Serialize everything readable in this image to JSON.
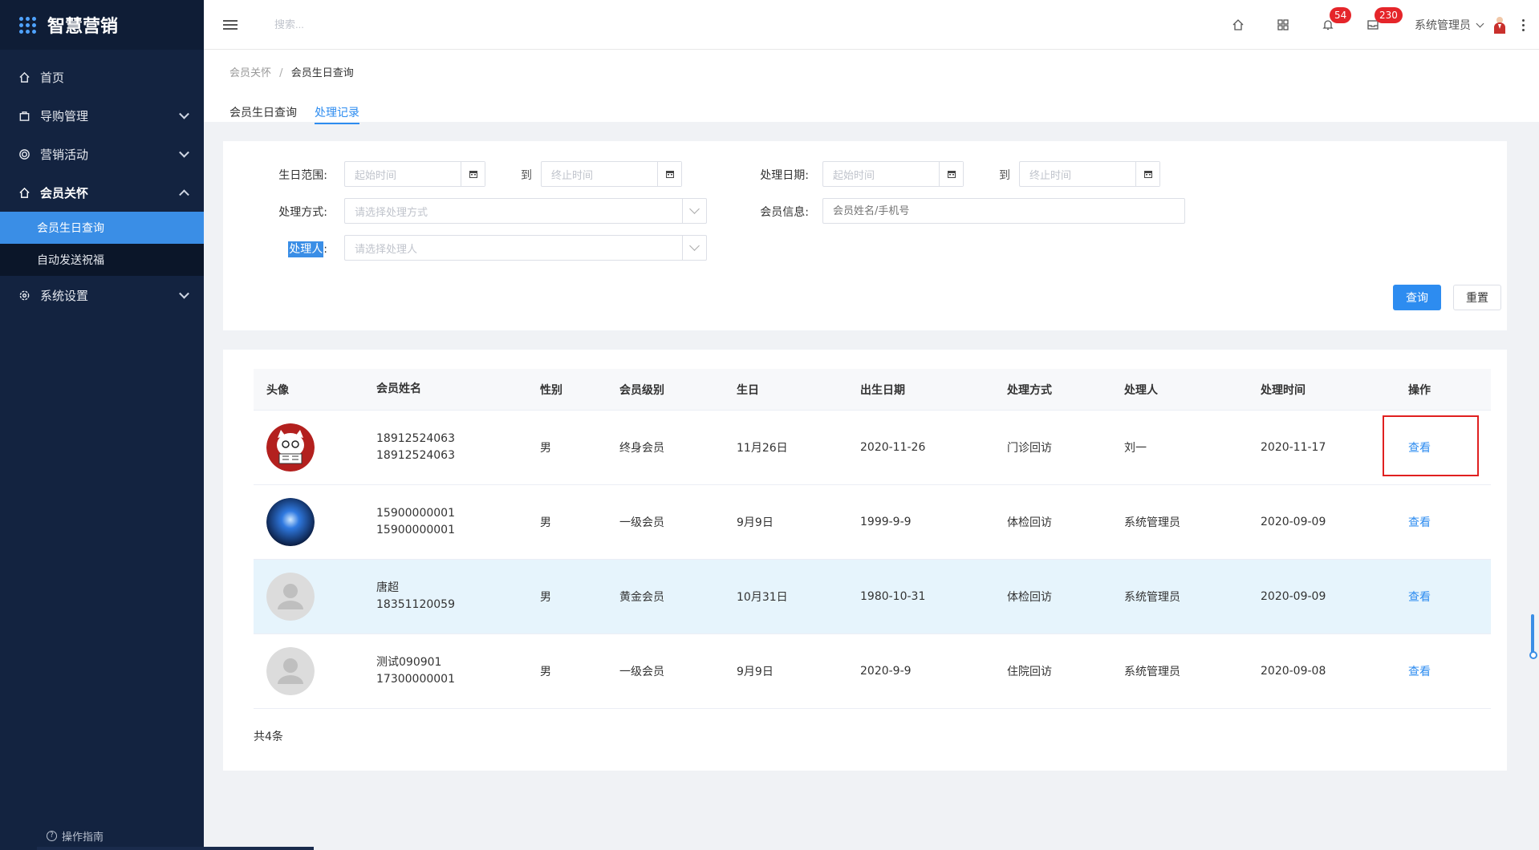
{
  "app": {
    "title": "智慧营销"
  },
  "sidebar": {
    "items": [
      {
        "label": "首页",
        "icon": "home-icon"
      },
      {
        "label": "导购管理",
        "icon": "bag-icon"
      },
      {
        "label": "营销活动",
        "icon": "target-icon"
      },
      {
        "label": "会员关怀",
        "icon": "house-heart-icon"
      },
      {
        "label": "系统设置",
        "icon": "gear-icon"
      }
    ],
    "submenu": [
      {
        "label": "会员生日查询",
        "active": true
      },
      {
        "label": "自动发送祝福",
        "active": false
      }
    ],
    "guide": "操作指南"
  },
  "header": {
    "search_placeholder": "搜索...",
    "notifications_badge": "54",
    "messages_badge": "230",
    "user_name": "系统管理员"
  },
  "breadcrumb": {
    "parent": "会员关怀",
    "sep": "/",
    "current": "会员生日查询"
  },
  "tabs": [
    {
      "label": "会员生日查询",
      "active": false
    },
    {
      "label": "处理记录",
      "active": true
    }
  ],
  "filters": {
    "birthday_label": "生日范围:",
    "process_date_label": "处理日期:",
    "start_placeholder": "起始时间",
    "end_placeholder": "终止时间",
    "to": "到",
    "method_label": "处理方式:",
    "method_placeholder": "请选择处理方式",
    "member_label": "会员信息:",
    "member_placeholder": "会员姓名/手机号",
    "handler_label": "处理人",
    "handler_colon": ":",
    "handler_placeholder": "请选择处理人",
    "search_button": "查询",
    "reset_button": "重置"
  },
  "table": {
    "headers": [
      "头像",
      "会员姓名",
      "性别",
      "会员级别",
      "生日",
      "出生日期",
      "处理方式",
      "处理人",
      "处理时间",
      "操作"
    ],
    "rows": [
      {
        "name": "18912524063",
        "phone": "18912524063",
        "gender": "男",
        "level": "终身会员",
        "birthday": "11月26日",
        "birth_date": "2020-11-26",
        "method": "门诊回访",
        "handler": "刘一",
        "time": "2020-11-17",
        "action": "查看",
        "avatar": "cartoon"
      },
      {
        "name": "15900000001",
        "phone": "15900000001",
        "gender": "男",
        "level": "一级会员",
        "birthday": "9月9日",
        "birth_date": "1999-9-9",
        "method": "体检回访",
        "handler": "系统管理员",
        "time": "2020-09-09",
        "action": "查看",
        "avatar": "windows"
      },
      {
        "name": "唐超",
        "phone": "18351120059",
        "gender": "男",
        "level": "黄金会员",
        "birthday": "10月31日",
        "birth_date": "1980-10-31",
        "method": "体检回访",
        "handler": "系统管理员",
        "time": "2020-09-09",
        "action": "查看",
        "avatar": "default"
      },
      {
        "name": "测试090901",
        "phone": "17300000001",
        "gender": "男",
        "level": "一级会员",
        "birthday": "9月9日",
        "birth_date": "2020-9-9",
        "method": "住院回访",
        "handler": "系统管理员",
        "time": "2020-09-08",
        "action": "查看",
        "avatar": "default"
      }
    ],
    "total": "共4条"
  },
  "colors": {
    "sidebar_bg": "#132340",
    "accent": "#2d8cf0",
    "badge": "#e5252a",
    "highlight_row": "#e6f4fc"
  }
}
